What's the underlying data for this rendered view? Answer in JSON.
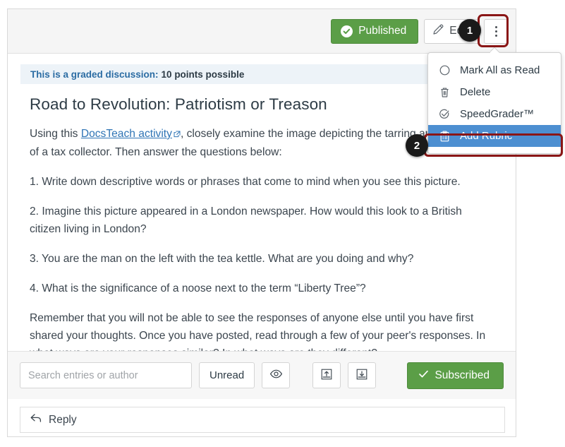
{
  "header": {
    "published_label": "Published",
    "published_icon": "check-circle-icon",
    "edit_label": "Edit",
    "edit_icon": "pencil-icon",
    "kebab_icon": "kebab-menu-icon",
    "published_color": "#5b9e47"
  },
  "badges": [
    {
      "number": "1"
    },
    {
      "number": "2"
    }
  ],
  "menu": {
    "items": [
      {
        "label": "Mark All as Read",
        "icon": "circle-unread-icon",
        "active": false
      },
      {
        "label": "Delete",
        "icon": "trash-icon",
        "active": false
      },
      {
        "label": "SpeedGrader™",
        "icon": "speedgrader-icon",
        "active": false
      },
      {
        "label": "Add Rubric",
        "icon": "rubric-clipboard-icon",
        "active": true
      }
    ],
    "highlight_color": "#8a1616",
    "active_color": "#4d8fd1"
  },
  "discussion": {
    "graded_banner_prefix": "This is a graded discussion:",
    "graded_banner_points": "10 points possible",
    "title": "Road to Revolution: Patriotism or Treason",
    "paragraphs": {
      "p1_before_link": "Using this ",
      "p1_link_text": "DocsTeach activity",
      "p1_after_link": ", closely examine the image depicting the tarring and feathering of a tax collector. Then answer the questions below:",
      "p2": "1. Write down descriptive words or phrases that come to mind when you see this picture.",
      "p3": "2. Imagine this picture appeared in a London newspaper. How would this look to a British citizen living in London?",
      "p4": "3. You are the man on the left with the tea kettle. What are you doing and why?",
      "p5": "4. What is the significance of a noose next to the term “Liberty Tree”?",
      "p6": "Remember that you will not be able to see the responses of anyone else until you have first shared your thoughts. Once you have posted, read through a few of your peer's responses. In what ways are your responses similar? In what ways are they different?"
    },
    "link_color": "#2f74b5",
    "banner_color": "#2b6ca3"
  },
  "toolbar": {
    "search_placeholder": "Search entries or author",
    "search_value": "",
    "unread_label": "Unread",
    "eye_icon": "eye-icon",
    "collapse_icon": "collapse-up-icon",
    "expand_icon": "expand-down-icon",
    "subscribed_label": "Subscribed",
    "subscribed_icon": "check-icon",
    "subscribed_color": "#5b9e47"
  },
  "reply": {
    "label": "Reply",
    "icon": "reply-arrow-icon"
  }
}
